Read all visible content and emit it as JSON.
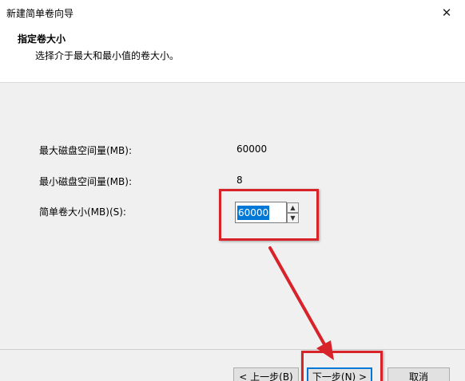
{
  "window": {
    "title": "新建简单卷向导",
    "close_glyph": "✕"
  },
  "header": {
    "title": "指定卷大小",
    "subtitle": "选择介于最大和最小值的卷大小。"
  },
  "form": {
    "max_label": "最大磁盘空间量(MB):",
    "max_value": "60000",
    "min_label": "最小磁盘空间量(MB):",
    "min_value": "8",
    "size_label": "简单卷大小(MB)(S):",
    "size_value": "60000"
  },
  "spinner": {
    "up_glyph": "▲",
    "down_glyph": "▼"
  },
  "buttons": {
    "back": "< 上一步(B)",
    "next": "下一步(N) >",
    "cancel": "取消"
  },
  "annotation_color": "#d8232a"
}
